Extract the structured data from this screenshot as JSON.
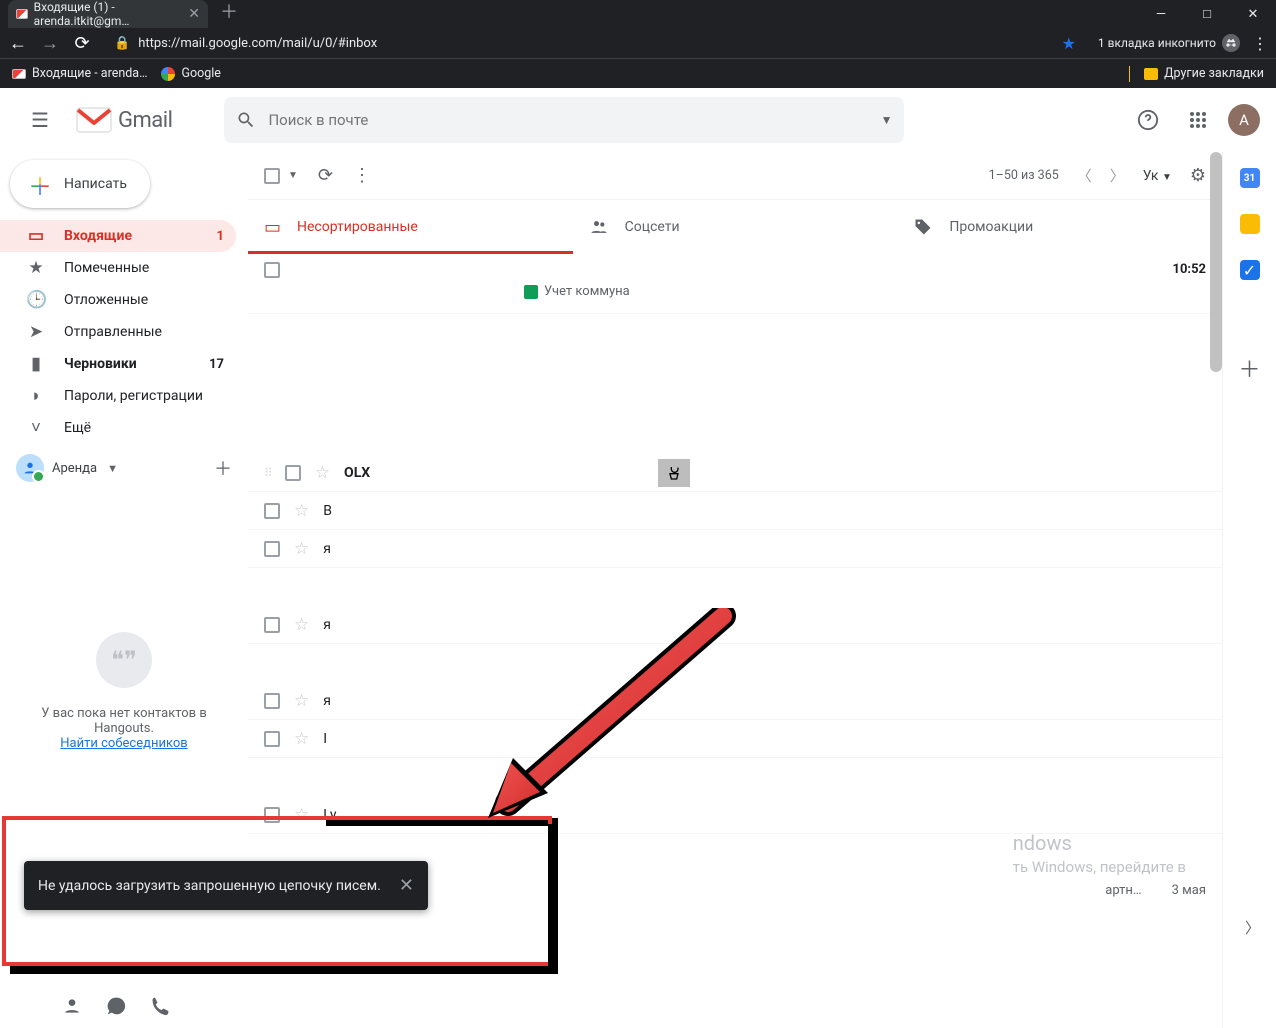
{
  "browser": {
    "tab_title": "Входящие (1) - arenda.itkit@gm…",
    "url": "https://mail.google.com/mail/u/0/#inbox",
    "incognito_label": "1 вкладка инкогнито",
    "bookmarks": [
      {
        "label": "Входящие - arenda…"
      },
      {
        "label": "Google"
      }
    ],
    "other_bookmarks": "Другие закладки"
  },
  "header": {
    "app_name": "Gmail",
    "search_placeholder": "Поиск в почте",
    "avatar_initial": "A"
  },
  "compose": {
    "label": "Написать"
  },
  "sidebar": {
    "items": [
      {
        "label": "Входящие",
        "count": "1"
      },
      {
        "label": "Помеченные"
      },
      {
        "label": "Отложенные"
      },
      {
        "label": "Отправленные"
      },
      {
        "label": "Черновики",
        "count": "17"
      },
      {
        "label": "Пароли, регистрации"
      },
      {
        "label": "Ещё"
      }
    ]
  },
  "hangouts": {
    "username": "Аренда",
    "no_contacts_1": "У вас пока нет контактов в",
    "no_contacts_2": "Hangouts.",
    "find_link": "Найти собеседников"
  },
  "toolbar": {
    "page_range": "1–50 из 365",
    "lang": "Ук"
  },
  "tabs": [
    {
      "label": "Несортированные"
    },
    {
      "label": "Соцсети"
    },
    {
      "label": "Промоакции"
    }
  ],
  "rows": [
    {
      "sender": "",
      "time": "10:52",
      "chip": "Учет коммуна"
    },
    {
      "sender": "OLX"
    },
    {
      "sender": "В"
    },
    {
      "sender": "я"
    },
    {
      "sender": "я"
    },
    {
      "sender": "я"
    },
    {
      "sender": "I"
    },
    {
      "sender": "Ly"
    }
  ],
  "bottom_row": {
    "snippet": "артн…",
    "date": "3 мая"
  },
  "snackbar": {
    "text": "Не удалось загрузить запрошенную цепочку писем."
  },
  "watermark": {
    "line1": "ndows",
    "line2": "ть Windows, перейдите в"
  }
}
